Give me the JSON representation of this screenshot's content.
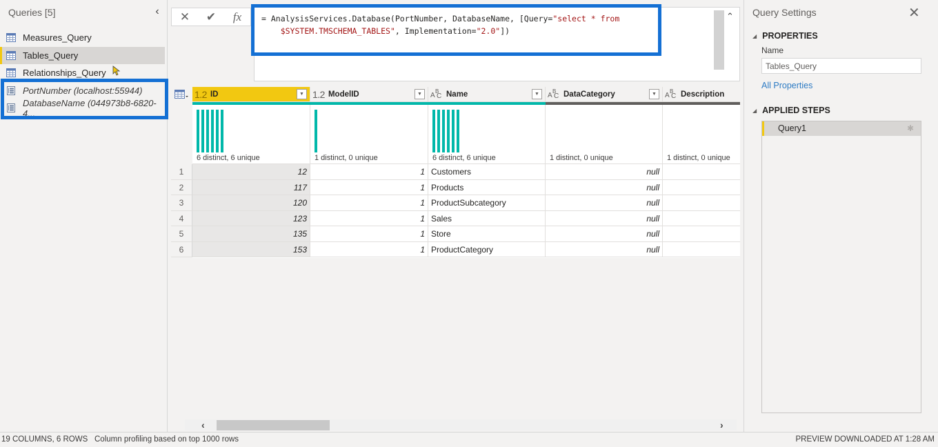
{
  "queries_pane": {
    "title": "Queries [5]",
    "collapse_icon": "chevron-left-icon",
    "items": [
      {
        "label": "Measures_Query",
        "icon": "table-icon",
        "type": "table"
      },
      {
        "label": "Tables_Query",
        "icon": "table-icon",
        "type": "table",
        "selected": true
      },
      {
        "label": "Relationships_Query",
        "icon": "table-icon",
        "type": "table"
      },
      {
        "label": "PortNumber (localhost:55944)",
        "icon": "parameter-icon",
        "type": "parameter"
      },
      {
        "label": "DatabaseName (044973b8-6820-4...",
        "icon": "parameter-icon",
        "type": "parameter"
      }
    ]
  },
  "formula_bar": {
    "cancel_icon": "close-icon",
    "commit_icon": "check-icon",
    "fx_label": "fx",
    "line1_prefix": "= AnalysisServices.Database(PortNumber, DatabaseName, [Query=",
    "line1_string": "\"select * from",
    "line2_string": "$SYSTEM.TMSCHEMA_TABLES\"",
    "line2_mid": ", Implementation=",
    "line2_string2": "\"2.0\"",
    "line2_suffix": "])"
  },
  "grid": {
    "columns": [
      {
        "name": "ID",
        "type": "1.2",
        "type_kind": "number",
        "selected": true,
        "quality_color": "#01b8aa",
        "profile": "6 distinct, 6 unique",
        "bars": 6
      },
      {
        "name": "ModelID",
        "type": "1.2",
        "type_kind": "number",
        "quality_color": "#01b8aa",
        "profile": "1 distinct, 0 unique",
        "bars": 1
      },
      {
        "name": "Name",
        "type": "ABC",
        "type_kind": "text",
        "quality_color": "#01b8aa",
        "profile": "6 distinct, 6 unique",
        "bars": 6
      },
      {
        "name": "DataCategory",
        "type": "ABC",
        "type_kind": "text",
        "quality_color": "#605e5c",
        "profile": "1 distinct, 0 unique",
        "bars": 0
      },
      {
        "name": "Description",
        "type": "ABC",
        "type_kind": "text",
        "quality_color": "#605e5c",
        "profile": "1 distinct, 0 unique",
        "bars": 0
      }
    ],
    "rows": [
      {
        "n": "1",
        "ID": "12",
        "ModelID": "1",
        "Name": "Customers",
        "DataCategory": "null",
        "Description": ""
      },
      {
        "n": "2",
        "ID": "117",
        "ModelID": "1",
        "Name": "Products",
        "DataCategory": "null",
        "Description": ""
      },
      {
        "n": "3",
        "ID": "120",
        "ModelID": "1",
        "Name": "ProductSubcategory",
        "DataCategory": "null",
        "Description": ""
      },
      {
        "n": "4",
        "ID": "123",
        "ModelID": "1",
        "Name": "Sales",
        "DataCategory": "null",
        "Description": ""
      },
      {
        "n": "5",
        "ID": "135",
        "ModelID": "1",
        "Name": "Store",
        "DataCategory": "null",
        "Description": ""
      },
      {
        "n": "6",
        "ID": "153",
        "ModelID": "1",
        "Name": "ProductCategory",
        "DataCategory": "null",
        "Description": ""
      }
    ]
  },
  "settings_pane": {
    "title": "Query Settings",
    "close_icon": "close-icon",
    "properties_heading": "PROPERTIES",
    "name_label": "Name",
    "name_value": "Tables_Query",
    "all_properties_link": "All Properties",
    "applied_steps_heading": "APPLIED STEPS",
    "steps": [
      {
        "label": "Query1",
        "icon": "gear-icon"
      }
    ]
  },
  "status_bar": {
    "counts": "19 COLUMNS, 6 ROWS",
    "profiling": "Column profiling based on top 1000 rows",
    "preview": "PREVIEW DOWNLOADED AT 1:28 AM"
  },
  "colors": {
    "accent_yellow": "#f2c811",
    "highlight_blue": "#1470d4",
    "profile_teal": "#01b8aa",
    "link_blue": "#2d7bc4",
    "formula_string": "#a31515"
  }
}
